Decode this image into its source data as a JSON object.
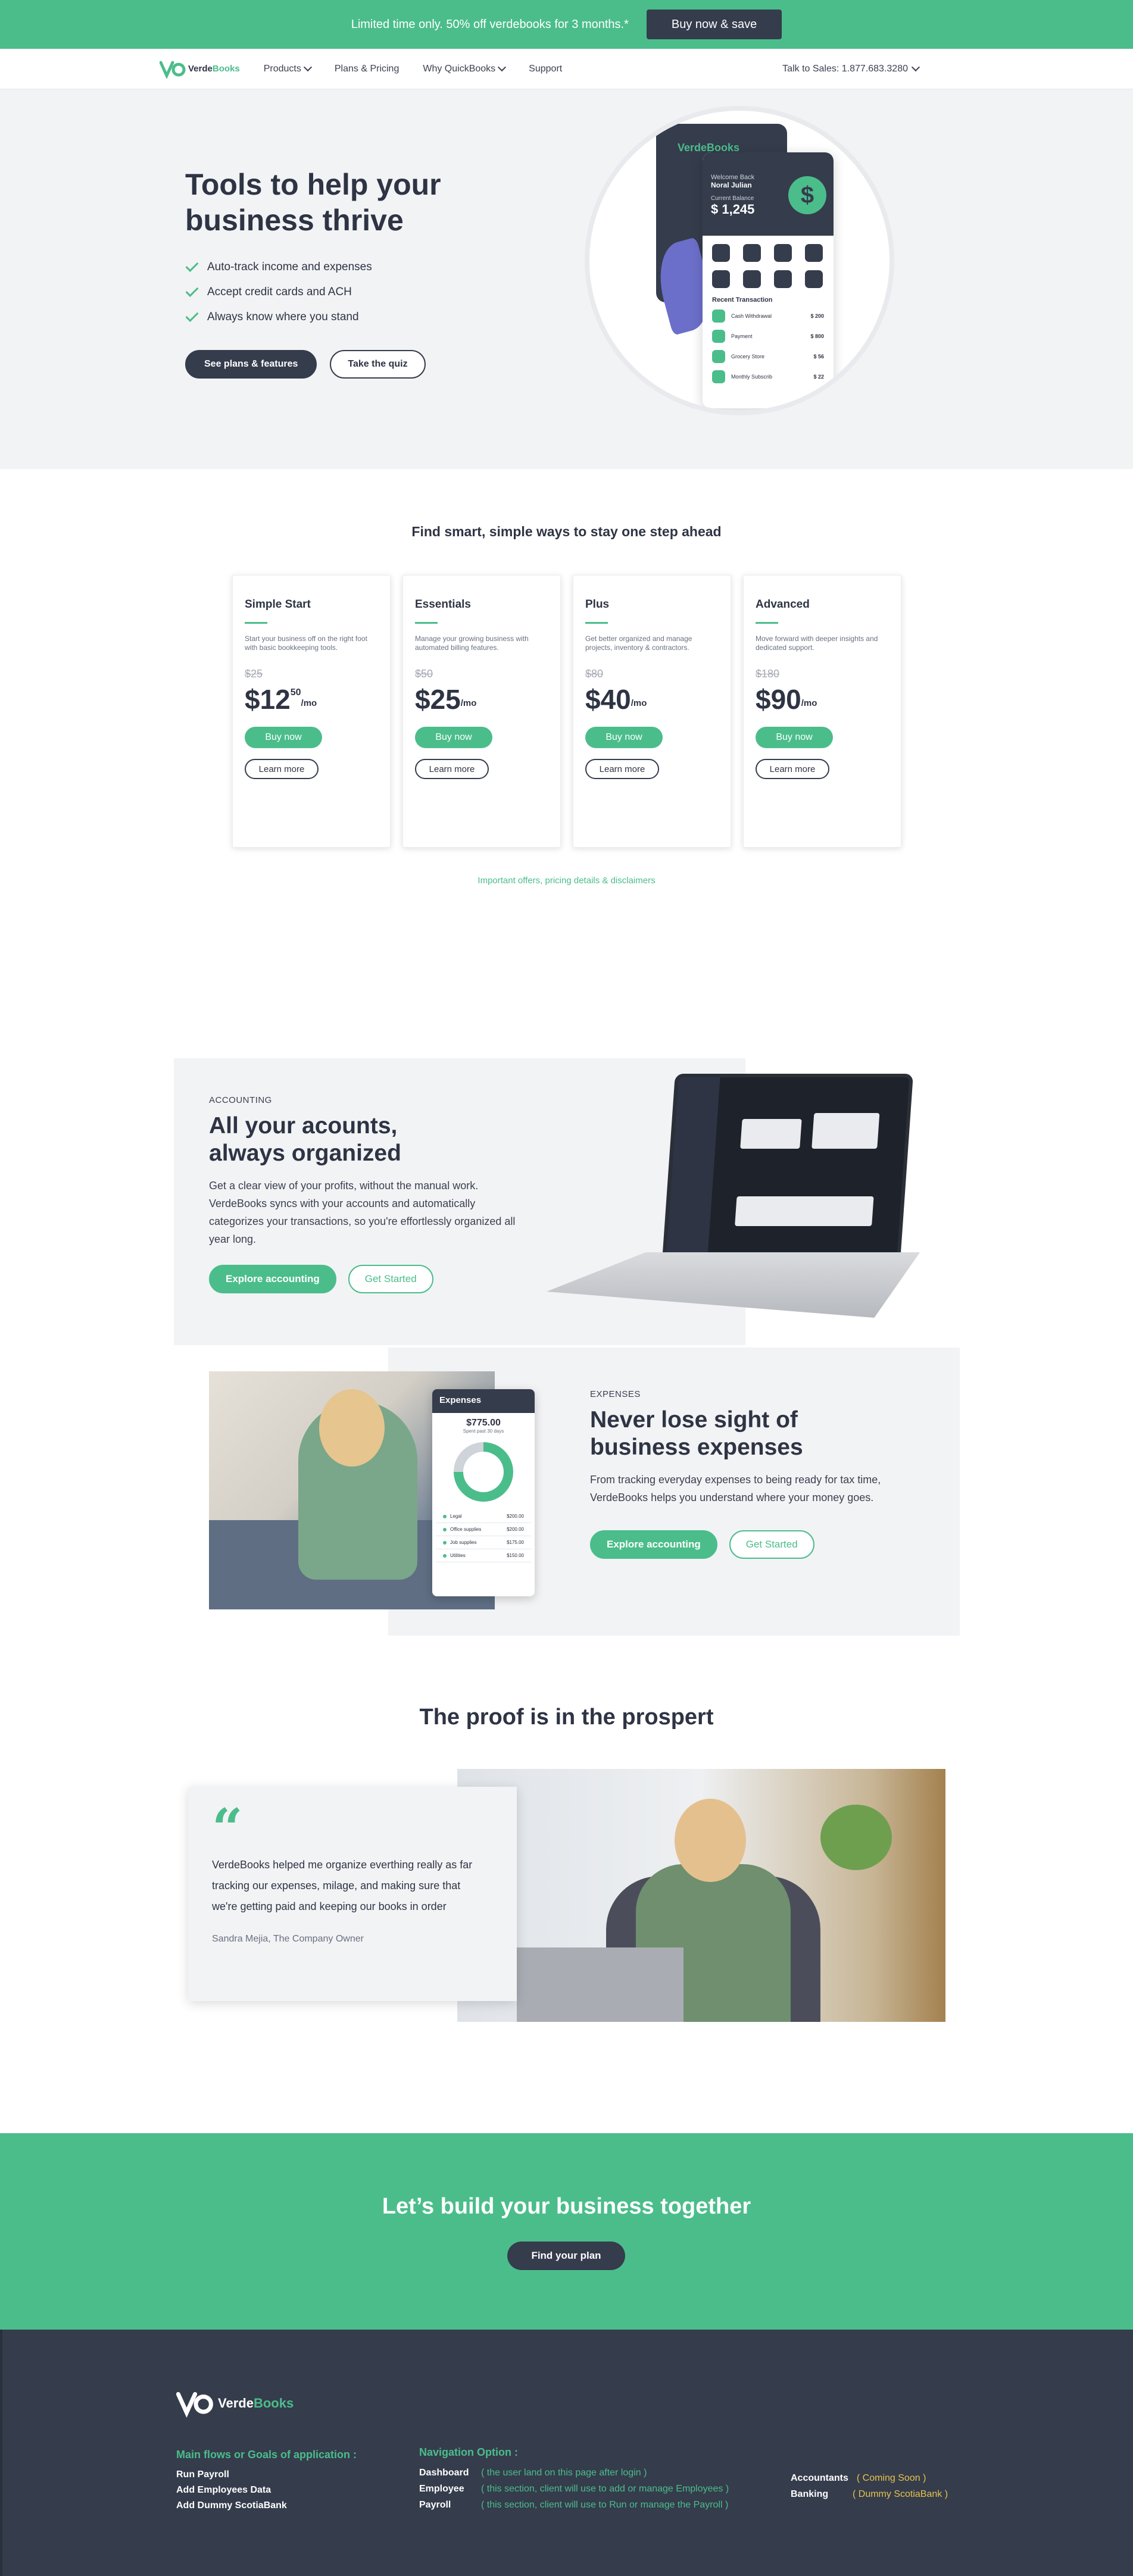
{
  "promo": {
    "text": "Limited time only. 50% off verdebooks for 3 months.*",
    "button": "Buy now & save"
  },
  "brand": {
    "name_dark": "Verde",
    "name_green": "Books",
    "accent": "#4bbd8b",
    "dark": "#353c4c"
  },
  "nav": {
    "items": [
      {
        "label": "Products",
        "dropdown": true
      },
      {
        "label": "Plans & Pricing",
        "dropdown": false
      },
      {
        "label": "Why QuickBooks",
        "dropdown": true
      },
      {
        "label": "Support",
        "dropdown": false
      }
    ],
    "sales": "Talk to Sales: 1.877.683.3280"
  },
  "hero": {
    "title": "Tools to help your business thrive",
    "bullets": [
      "Auto-track income and expenses",
      "Accept credit cards and ACH",
      "Always know where you stand"
    ],
    "primary": "See plans & features",
    "secondary": "Take the quiz",
    "phone": {
      "brand": "VerdeBooks",
      "hello": "Welcome Back",
      "name": "Noral Julian",
      "balance_label": "Current Balance",
      "balance": "$ 1,245",
      "recent_title": "Recent Transaction",
      "transactions": [
        {
          "label": "Cash Withdrawal",
          "amount": "$ 200"
        },
        {
          "label": "Payment",
          "amount": "$ 800"
        },
        {
          "label": "Grocery Store",
          "amount": "$ 56"
        },
        {
          "label": "Monthly Subscrib",
          "amount": "$ 22"
        }
      ]
    }
  },
  "plans": {
    "heading": "Find smart, simple ways to stay one step ahead",
    "cards": [
      {
        "name": "Simple Start",
        "desc": "Start your business off on the right foot with basic bookkeeping tools.",
        "old": "$25",
        "price": "$12",
        "cents": "50",
        "per": "/mo",
        "buy": "Buy now",
        "learn": "Learn more"
      },
      {
        "name": "Essentials",
        "desc": "Manage your growing business with automated billing features.",
        "old": "$50",
        "price": "$25",
        "cents": "",
        "per": "/mo",
        "buy": "Buy now",
        "learn": "Learn more"
      },
      {
        "name": "Plus",
        "desc": "Get better organized and manage projects, inventory & contractors.",
        "old": "$80",
        "price": "$40",
        "cents": "",
        "per": "/mo",
        "buy": "Buy now",
        "learn": "Learn more"
      },
      {
        "name": "Advanced",
        "desc": "Move forward with deeper insights and dedicated support.",
        "old": "$180",
        "price": "$90",
        "cents": "",
        "per": "/mo",
        "buy": "Buy now",
        "learn": "Learn more"
      }
    ],
    "disclaimer": "Important offers, pricing details & disclaimers"
  },
  "accounting": {
    "eyebrow": "ACCOUNTING",
    "title_line1": "All your acounts,",
    "title_line2": "always organized",
    "body": "Get a clear view of your profits, without the manual work. VerdeBooks syncs with your accounts and automatically categorizes your transactions, so you're effortlessly organized all year long.",
    "primary": "Explore accounting",
    "secondary": "Get Started"
  },
  "expenses": {
    "eyebrow": "EXPENSES",
    "title_line1": "Never lose sight of",
    "title_line2": "business expenses",
    "body": "From tracking everyday expenses to being ready for tax time, VerdeBooks helps you understand where your money goes.",
    "primary": "Explore accounting",
    "secondary": "Get Started",
    "card": {
      "title": "Expenses",
      "amount": "$775.00",
      "sub": "Spent past 30 days",
      "items": [
        {
          "label": "Legal",
          "amount": "$200.00"
        },
        {
          "label": "Office supplies",
          "amount": "$200.00"
        },
        {
          "label": "Job supplies",
          "amount": "$175.00"
        },
        {
          "label": "Utilities",
          "amount": "$150.00"
        }
      ]
    }
  },
  "proof": {
    "title": "The proof is in the prospert",
    "quote": "VerdeBooks helped me organize everthing really as far tracking our expenses, milage, and making sure that we're getting paid and keeping our books in order",
    "author": "Sandra Mejia, The Company Owner"
  },
  "cta": {
    "title": "Let’s build your business together",
    "button": "Find your plan"
  },
  "footer": {
    "col1_head": "Main flows or Goals of application :",
    "col1_items": [
      "Run Payroll",
      "Add Employees Data",
      "Add Dummy ScotiaBank"
    ],
    "col2_head": "Navigation Option :",
    "col2_rows": [
      {
        "k": "Dashboard",
        "v": "( the user land on this page after login )"
      },
      {
        "k": "Employee",
        "v": "( this section, client will use to add or manage Employees )"
      },
      {
        "k": "Payroll",
        "v": "( this section, client will use to Run or manage the Payroll )"
      }
    ],
    "col3_rows": [
      {
        "k": "Accountants",
        "v": "( Coming Soon )"
      },
      {
        "k": "Banking",
        "v": "( Dummy ScotiaBank )"
      }
    ]
  }
}
